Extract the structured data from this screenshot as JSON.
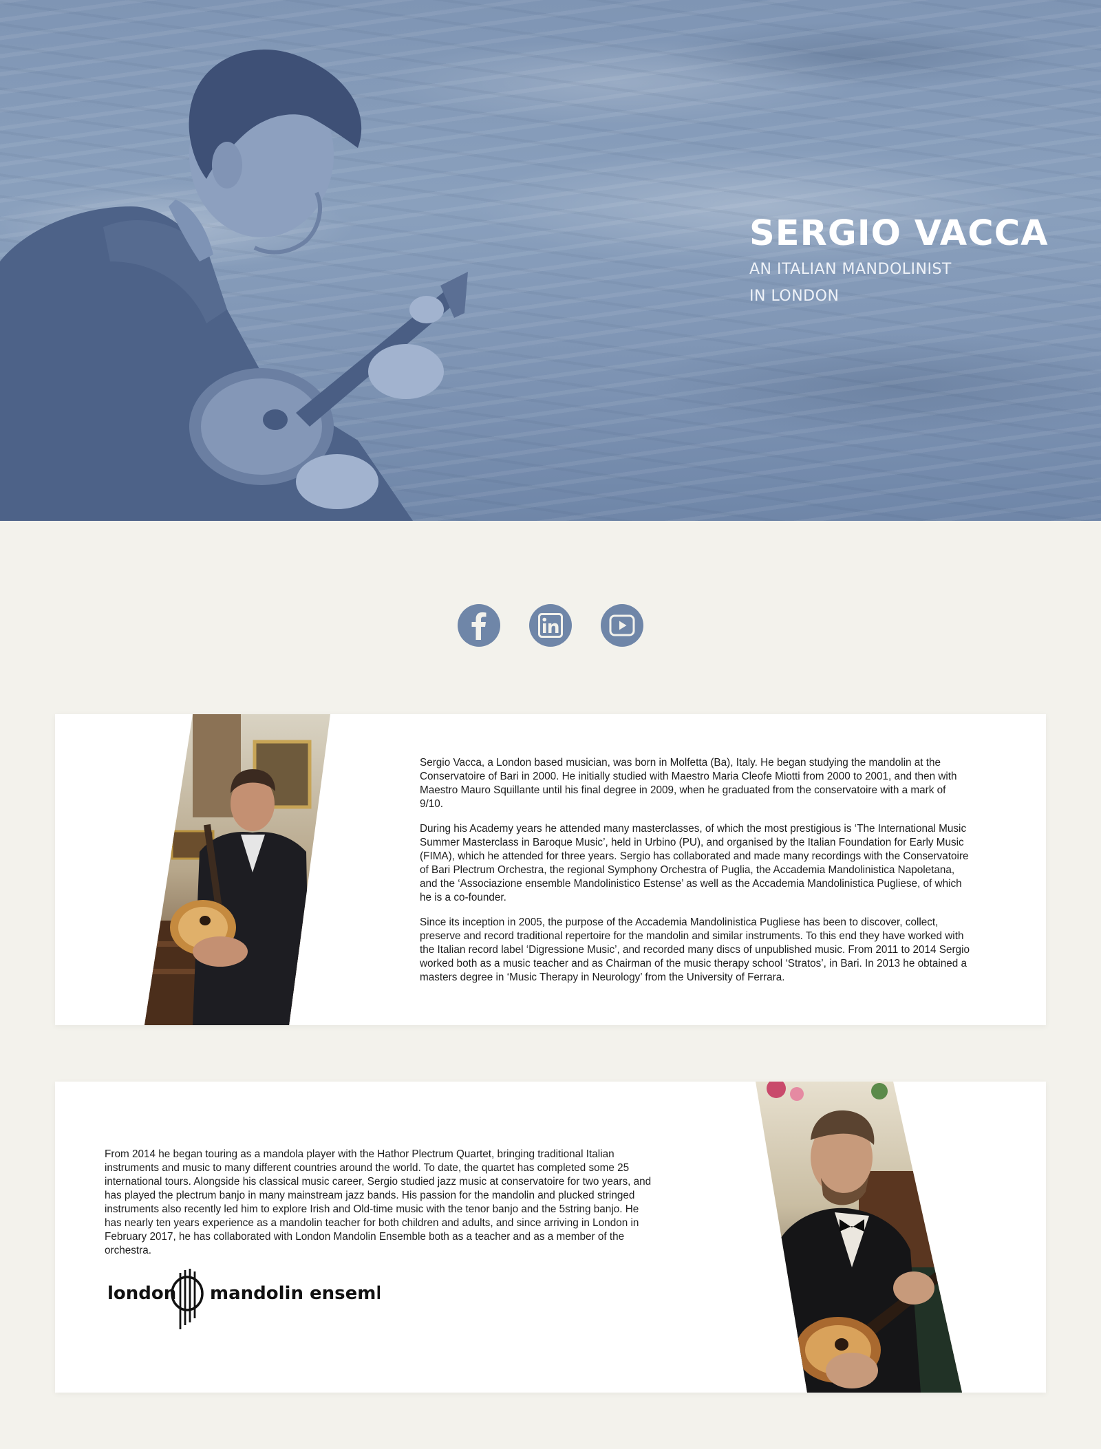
{
  "hero": {
    "title": "SERGIO VACCA",
    "subtitle_line1": "AN ITALIAN MANDOLINIST",
    "subtitle_line2": "IN LONDON",
    "image": "portrait-with-mandolin-sea-background",
    "overlay_color": "#7f95b4"
  },
  "social": {
    "accent_color": "#6f86a8",
    "items": [
      {
        "name": "Facebook",
        "icon": "facebook-icon"
      },
      {
        "name": "LinkedIn",
        "icon": "linkedin-icon"
      },
      {
        "name": "YouTube",
        "icon": "youtube-icon"
      }
    ]
  },
  "bio1": {
    "image": "portrait-in-suit-holding-mandolin",
    "paragraphs": [
      "Sergio Vacca, a London based musician, was born in Molfetta (Ba), Italy. He began studying the mandolin at the Conservatoire of Bari in 2000. He initially studied with Maestro Maria Cleofe Miotti from 2000 to 2001, and then with Maestro Mauro Squillante until his final degree in 2009, when he graduated from the conservatoire with a mark of 9/10.",
      "During his Academy years he attended many masterclasses, of which the most prestigious is ‘The International Music Summer Masterclass in Baroque Music’, held in Urbino (PU), and organised by the Italian Foundation for Early Music (FIMA), which he attended for three years. Sergio has collaborated and made many recordings with the Conservatoire of Bari Plectrum Orchestra, the regional Symphony Orchestra of Puglia, the Accademia Mandolinistica Napoletana, and the ‘Associazione ensemble Mandolinistico Estense’ as well as the Accademia Mandolinistica Pugliese, of which he is a co-founder.",
      "Since its inception in 2005, the purpose of the Accademia Mandolinistica Pugliese has been to discover, collect, preserve and record traditional repertoire for the mandolin and similar instruments. To this end they have worked with the Italian record label ‘Digressione Music’, and recorded many discs of unpublished music. From 2011 to 2014 Sergio worked both as a music teacher and as Chairman of the music therapy school ‘Stratos’, in Bari. In 2013 he obtained a masters degree in ‘Music Therapy in Neurology’ from the University of Ferrara."
    ]
  },
  "bio2": {
    "image": "performing-mandolin-in-tuxedo",
    "paragraphs": [
      "From 2014 he began touring as a mandola player with the Hathor Plectrum Quartet, bringing traditional Italian instruments and music to many different countries around the world. To date, the quartet has completed some 25 international tours. Alongside his classical music career, Sergio studied jazz music at conservatoire for two years, and has played the plectrum banjo in many mainstream jazz bands. His passion for the mandolin and plucked stringed instruments also recently led him to explore Irish and Old-time music with the tenor banjo and the 5string banjo. He has nearly ten years experience as a mandolin teacher for both children and adults, and since arriving in London in February 2017, he has collaborated with London Mandolin Ensemble both as a teacher and as a member of the orchestra."
    ],
    "logo": {
      "left_text": "london",
      "right_text": "mandolin ensemble"
    }
  }
}
